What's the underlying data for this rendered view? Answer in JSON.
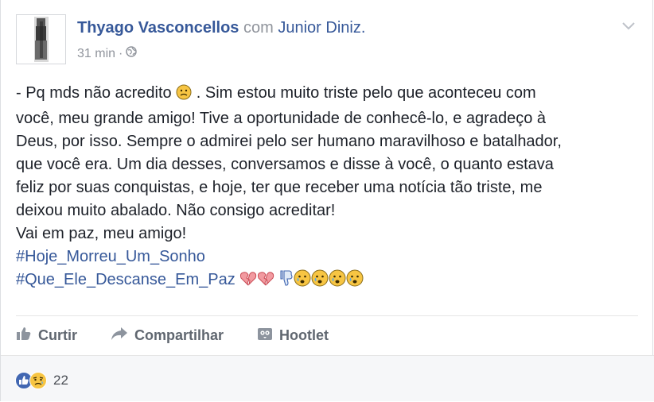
{
  "post": {
    "author": "Thyago Vasconcellos",
    "with_word": "com",
    "tagged": "Junior Diniz.",
    "time": "31 min",
    "separator": "·",
    "lines": [
      "- Pq mds não acredito",
      ". Sim estou muito triste pelo que aconteceu com",
      "você, meu grande amigo! Tive a oportunidade de conhecê-lo, e agradeço à",
      "Deus, por isso. Sempre o admirei pelo ser humano maravilhoso e batalhador,",
      "que você era. Um dia desses, conversamos e disse à você, o quanto estava",
      "feliz por suas conquistas, e hoje, ter que receber uma notícia tão triste, me",
      "deixou muito abalado. Não consigo acreditar!",
      "Vai em paz, meu amigo!"
    ],
    "hashtags": [
      "#Hoje_Morreu_Um_Sonho",
      "#Que_Ele_Descanse_Em_Paz"
    ]
  },
  "actions": {
    "like": "Curtir",
    "share": "Compartilhar",
    "hootlet": "Hootlet"
  },
  "reactions": {
    "count": "22"
  },
  "colors": {
    "link": "#365899",
    "muted": "#90949c",
    "action": "#606770",
    "like_blue": "#4267b2",
    "sad_yellow": "#f7c543"
  }
}
